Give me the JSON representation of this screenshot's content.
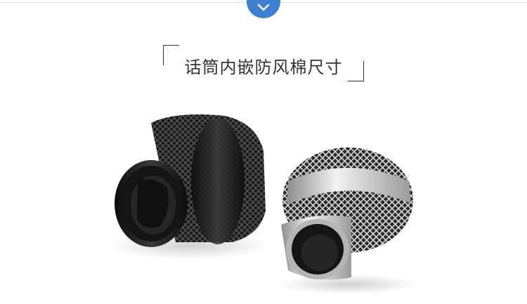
{
  "header": {
    "title": "话筒内嵌防风棉尺寸",
    "badge_icon": "chevron-down-icon"
  },
  "colors": {
    "accent": "#3d7fd0",
    "text": "#333333",
    "rule": "#e6e6e6"
  },
  "image": {
    "subjects": [
      "black-mic-grille-icon",
      "silver-mic-grille-icon"
    ]
  }
}
